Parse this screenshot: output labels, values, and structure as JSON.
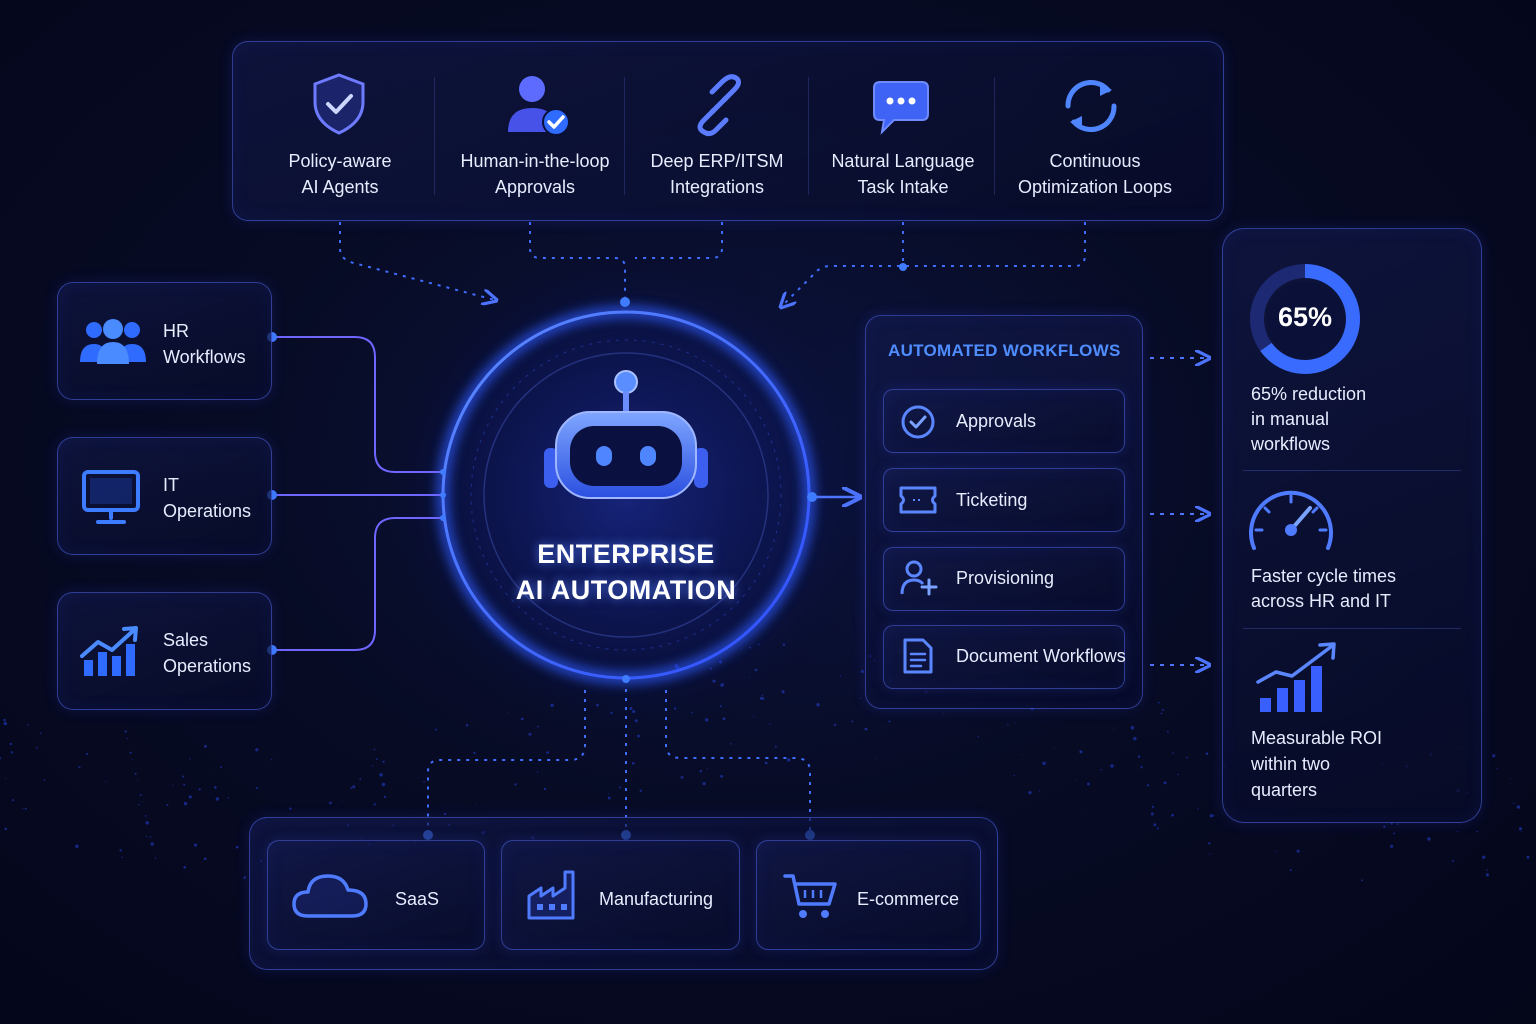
{
  "features": [
    {
      "line1": "Policy-aware",
      "line2": "AI Agents",
      "icon": "shield-check-icon"
    },
    {
      "line1": "Human-in-the-loop",
      "line2": "Approvals",
      "icon": "user-check-icon"
    },
    {
      "line1": "Deep ERP/ITSM",
      "line2": "Integrations",
      "icon": "link-icon"
    },
    {
      "line1": "Natural Language",
      "line2": "Task Intake",
      "icon": "chat-bubble-icon"
    },
    {
      "line1": "Continuous",
      "line2": "Optimization Loops",
      "icon": "refresh-icon"
    }
  ],
  "inputs": [
    {
      "line1": "HR",
      "line2": "Workflows",
      "icon": "team-icon"
    },
    {
      "line1": "IT",
      "line2": "Operations",
      "icon": "monitor-icon"
    },
    {
      "line1": "Sales",
      "line2": "Operations",
      "icon": "growth-chart-icon"
    }
  ],
  "hub": {
    "line1": "ENTERPRISE",
    "line2": "AI AUTOMATION",
    "icon": "robot-icon"
  },
  "workflows": {
    "title": "AUTOMATED WORKFLOWS",
    "items": [
      {
        "label": "Approvals",
        "icon": "check-circle-icon"
      },
      {
        "label": "Ticketing",
        "icon": "ticket-icon"
      },
      {
        "label": "Provisioning",
        "icon": "user-add-icon"
      },
      {
        "label": "Document Workflows",
        "icon": "document-icon"
      }
    ]
  },
  "outcomes": [
    {
      "value": "65%",
      "value_fraction": 0.65,
      "lines": [
        "65% reduction",
        "in manual",
        "workflows"
      ],
      "icon": "donut-gauge-icon"
    },
    {
      "lines": [
        "Faster cycle times",
        "across HR and IT"
      ],
      "icon": "speedometer-icon"
    },
    {
      "lines": [
        "Measurable ROI",
        "within two",
        "quarters"
      ],
      "icon": "roi-chart-icon"
    }
  ],
  "industries": [
    {
      "label": "SaaS",
      "icon": "cloud-icon"
    },
    {
      "label": "Manufacturing",
      "icon": "factory-icon"
    },
    {
      "label": "E-commerce",
      "icon": "cart-icon"
    }
  ],
  "colors": {
    "accent": "#3f7cff",
    "violet": "#7b6cff",
    "title": "#4f8dff",
    "background": "#05081d"
  }
}
